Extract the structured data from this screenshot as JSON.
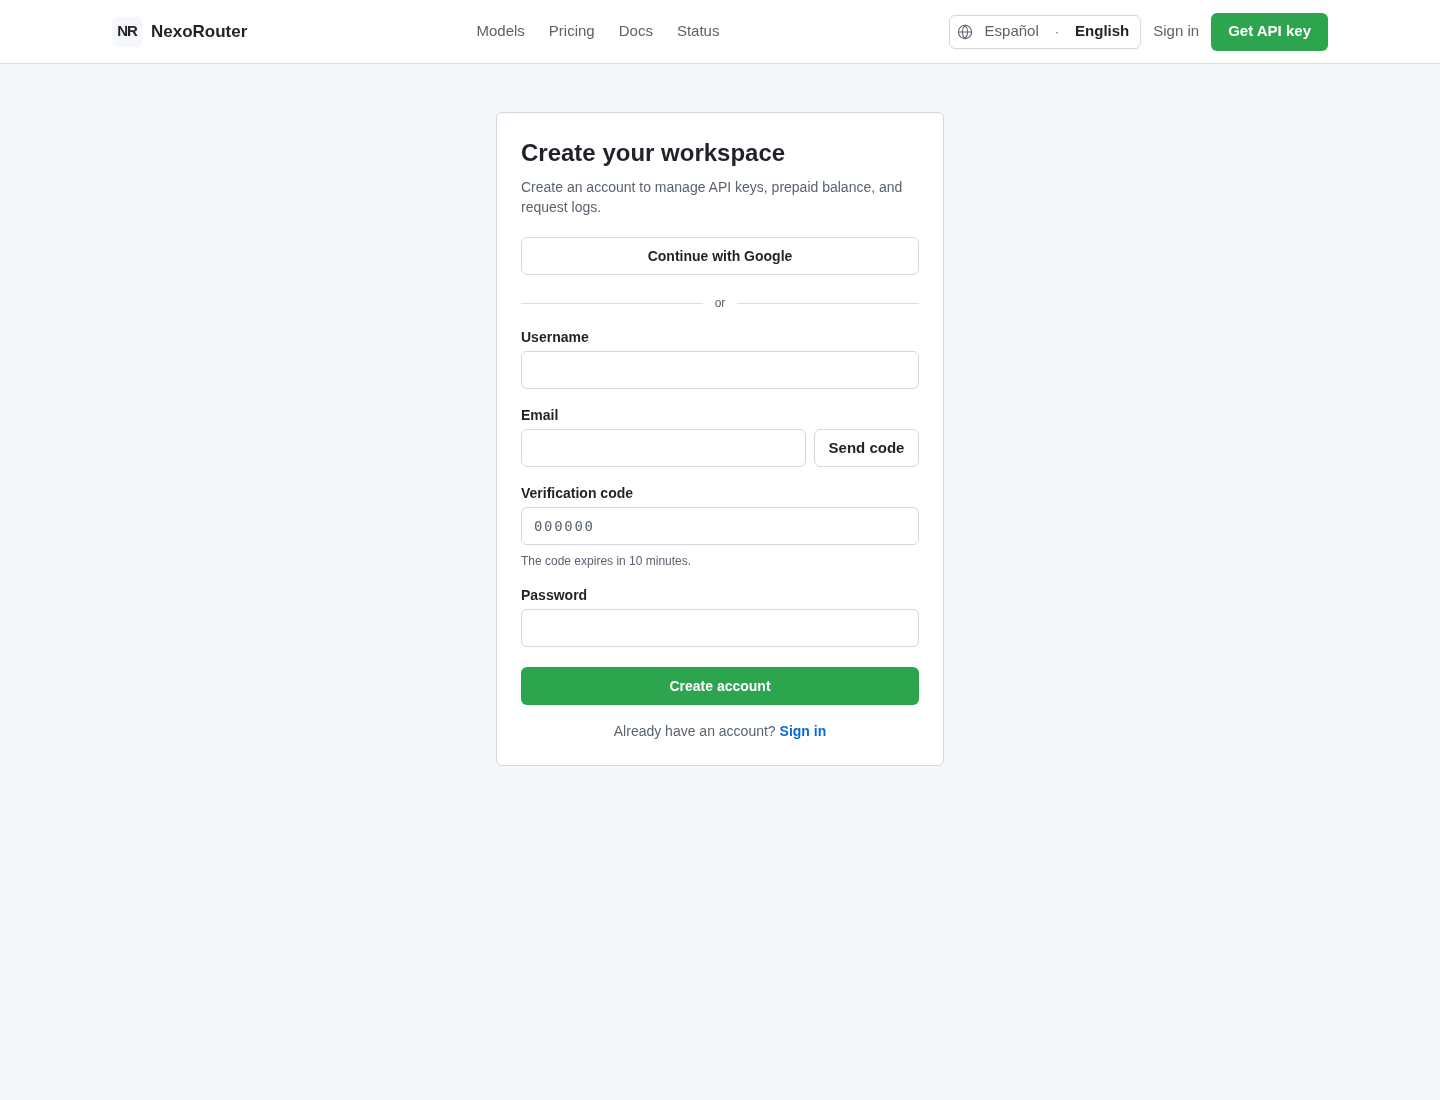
{
  "header": {
    "brand": {
      "mark": "NR",
      "name": "NexoRouter"
    },
    "nav": [
      "Models",
      "Pricing",
      "Docs",
      "Status"
    ],
    "languages": [
      {
        "label": "Español",
        "selected": false
      },
      {
        "label": "English",
        "selected": true
      }
    ],
    "language_separator": "·",
    "sign_in": "Sign in",
    "cta": "Get API key"
  },
  "form": {
    "title": "Create your workspace",
    "subtitle": "Create an account to manage API keys, prepaid balance, and request logs.",
    "google_button": "Continue with Google",
    "divider": "or",
    "fields": [
      {
        "kind": "text",
        "label": "Username"
      },
      {
        "kind": "email",
        "label": "Email",
        "button": "Send code"
      },
      {
        "kind": "code",
        "label": "Verification code",
        "placeholder": "000000",
        "hint": "The code expires in 10 minutes."
      },
      {
        "kind": "password",
        "label": "Password"
      }
    ],
    "submit": "Create account",
    "footer": {
      "text": "Already have an account?",
      "link": "Sign in"
    }
  }
}
